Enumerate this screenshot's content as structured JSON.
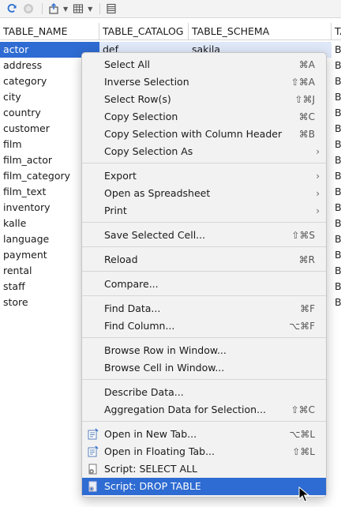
{
  "toolbar": {
    "icons": [
      "refresh-icon",
      "stop-icon",
      "export-icon",
      "grid-icon",
      "columns-icon"
    ]
  },
  "table": {
    "columns": [
      "TABLE_NAME",
      "TABLE_CATALOG",
      "TABLE_SCHEMA",
      "TA"
    ],
    "selected_row": {
      "name": "actor",
      "catalog": "def",
      "schema": "sakila"
    },
    "rows": [
      {
        "name": "address",
        "d": "BA"
      },
      {
        "name": "category",
        "d": "BA"
      },
      {
        "name": "city",
        "d": "BA"
      },
      {
        "name": "country",
        "d": "BA"
      },
      {
        "name": "customer",
        "d": "BA"
      },
      {
        "name": "film",
        "d": "BA"
      },
      {
        "name": "film_actor",
        "d": "BA"
      },
      {
        "name": "film_category",
        "d": "BA"
      },
      {
        "name": "film_text",
        "d": "BA"
      },
      {
        "name": "inventory",
        "d": "BA"
      },
      {
        "name": "kalle",
        "d": "BA"
      },
      {
        "name": "language",
        "d": "BA"
      },
      {
        "name": "payment",
        "d": "BA"
      },
      {
        "name": "rental",
        "d": "BA"
      },
      {
        "name": "staff",
        "d": "BA"
      },
      {
        "name": "store",
        "d": "BA"
      }
    ],
    "first_row_d": "BA"
  },
  "menu": {
    "select_all": {
      "label": "Select All",
      "shortcut": "⌘A"
    },
    "inverse_selection": {
      "label": "Inverse Selection",
      "shortcut": "⇧⌘A"
    },
    "select_rows": {
      "label": "Select Row(s)",
      "shortcut": "⇧⌘J"
    },
    "copy_selection": {
      "label": "Copy Selection",
      "shortcut": "⌘C"
    },
    "copy_selection_header": {
      "label": "Copy Selection with Column Header",
      "shortcut": "⌘B"
    },
    "copy_selection_as": {
      "label": "Copy Selection As"
    },
    "export": {
      "label": "Export"
    },
    "open_spreadsheet": {
      "label": "Open as Spreadsheet"
    },
    "print": {
      "label": "Print"
    },
    "save_selected_cell": {
      "label": "Save Selected Cell...",
      "shortcut": "⇧⌘S"
    },
    "reload": {
      "label": "Reload",
      "shortcut": "⌘R"
    },
    "compare": {
      "label": "Compare..."
    },
    "find_data": {
      "label": "Find Data...",
      "shortcut": "⌘F"
    },
    "find_column": {
      "label": "Find Column...",
      "shortcut": "⌥⌘F"
    },
    "browse_row": {
      "label": "Browse Row in Window..."
    },
    "browse_cell": {
      "label": "Browse Cell in Window..."
    },
    "describe_data": {
      "label": "Describe Data..."
    },
    "aggregation": {
      "label": "Aggregation Data for Selection...",
      "shortcut": "⇧⌘C"
    },
    "open_new_tab": {
      "label": "Open in New Tab...",
      "shortcut": "⌥⌘L"
    },
    "open_floating_tab": {
      "label": "Open in Floating Tab...",
      "shortcut": "⇧⌘L"
    },
    "script_select_all": {
      "label": "Script: SELECT ALL"
    },
    "script_drop_table": {
      "label": "Script: DROP TABLE"
    }
  },
  "colors": {
    "selection": "#2e6bd2",
    "menu_bg": "#f2f2f2"
  }
}
